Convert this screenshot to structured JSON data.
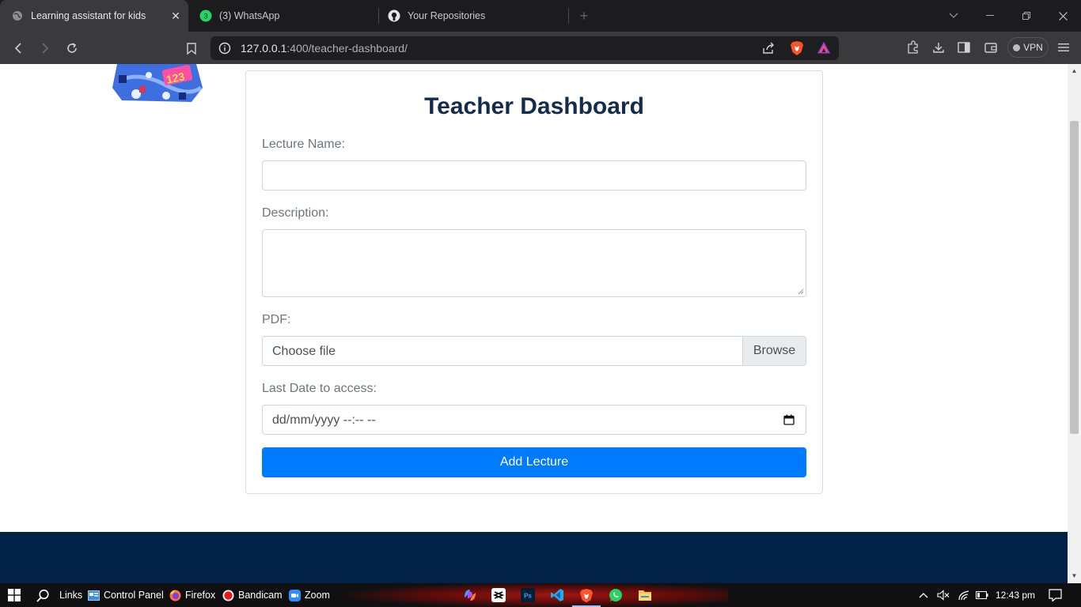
{
  "browser": {
    "tabs": [
      {
        "label": "Learning assistant for kids",
        "active": true
      },
      {
        "label": "(3) WhatsApp",
        "badge": "3"
      },
      {
        "label": "Your Repositories"
      }
    ],
    "address": {
      "host": "127.0.0.1",
      "rest": ":400/teacher-dashboard/"
    },
    "vpn_label": "VPN",
    "colors": {
      "tab_bg": "#1c1c1e",
      "toolbar_bg": "#3a3a3c"
    }
  },
  "page": {
    "logo_text": "123",
    "title": "Teacher Dashboard",
    "form": {
      "lecture_name_label": "Lecture Name:",
      "lecture_name_value": "",
      "description_label": "Description:",
      "description_value": "",
      "pdf_label": "PDF:",
      "file_placeholder": "Choose file",
      "browse_label": "Browse",
      "last_date_label": "Last Date to access:",
      "date_placeholder": "dd/mm/yyyy --:-- --",
      "submit_label": "Add Lecture"
    },
    "colors": {
      "primary": "#007bff",
      "title": "#132b4c",
      "footer": "#022147"
    }
  },
  "taskbar": {
    "links_label": "Links",
    "control_panel_label": "Control Panel",
    "firefox_label": "Firefox",
    "bandicam_label": "Bandicam",
    "zoom_label": "Zoom",
    "time": "12:43 pm"
  }
}
